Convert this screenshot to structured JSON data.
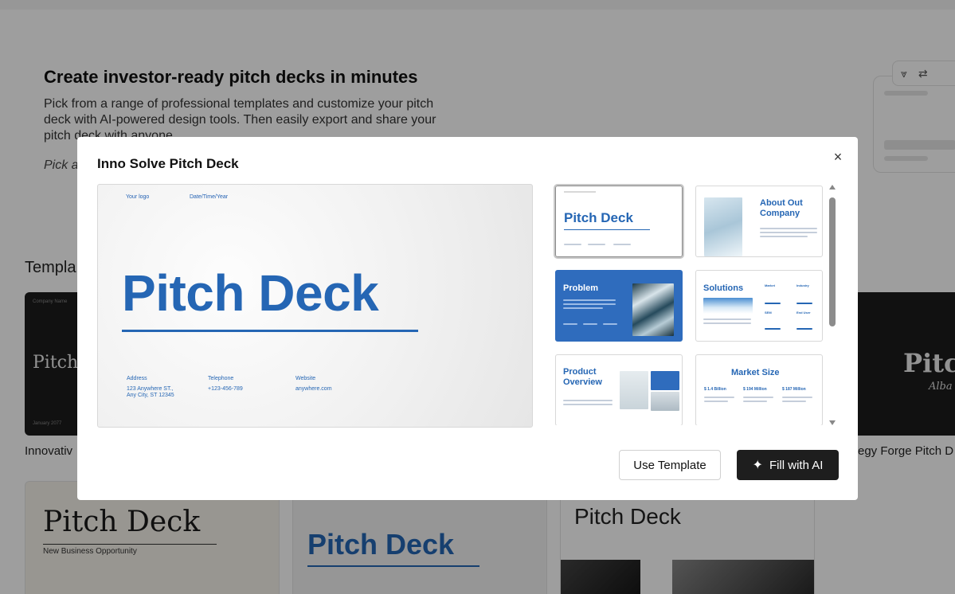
{
  "hero": {
    "title": "Create investor-ready pitch decks in minutes",
    "description": "Pick from a range of professional templates and customize your pitch deck with AI-powered design tools. Then easily export and share your pitch deck with anyone.",
    "pick_text": "Pick a"
  },
  "section": {
    "label": "Templa"
  },
  "side_toolbar": {
    "icons": [
      "shapes-icon",
      "swap-icon"
    ]
  },
  "cards": {
    "card1": {
      "caption": "Innovativ",
      "title": "Pitch",
      "top_text": "Company Name",
      "bottom_text": "January 2077"
    },
    "card2": {
      "caption": "egy Forge Pitch D",
      "title": "Pitch",
      "subtitle": "Alba"
    },
    "card3": {
      "title": "Pitch Deck",
      "subtitle": "New Business Opportunity"
    },
    "card4": {
      "title": "Pitch Deck"
    },
    "card5": {
      "title": "Pitch Deck"
    }
  },
  "modal": {
    "title": "Inno Solve Pitch Deck",
    "close_label": "×",
    "preview": {
      "logo": "Your logo",
      "date": "Date/Time/Year",
      "title": "Pitch Deck",
      "address_label": "Address",
      "address_value_1": "123 Anywhere ST.,",
      "address_value_2": "Any City, ST 12345",
      "telephone_label": "Telephone",
      "telephone_value": "+123-456-789",
      "website_label": "Website",
      "website_value": "anywhere.com"
    },
    "thumbnails": [
      {
        "title": "Pitch Deck",
        "selected": true
      },
      {
        "title_line1": "About Out",
        "title_line2": "Company"
      },
      {
        "title": "Problem"
      },
      {
        "title": "Solutions",
        "labels": [
          "Market",
          "Industry",
          "SEM",
          "End User"
        ]
      },
      {
        "title_line1": "Product",
        "title_line2": "Overview"
      },
      {
        "title": "Market Size",
        "values": [
          "$ 1.4 Billion",
          "$ 194 Million",
          "$ 187 Million"
        ]
      }
    ],
    "buttons": {
      "use_template": "Use Template",
      "fill_ai": "Fill with AI"
    }
  },
  "colors": {
    "accent_blue": "#2566b4",
    "dark_button": "#1e1e1e"
  }
}
